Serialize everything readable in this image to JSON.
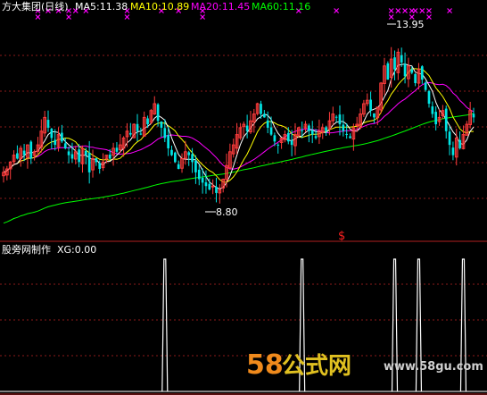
{
  "colors": {
    "background": "#000000",
    "up_candle": "#ff3c3c",
    "down_candle": "#00e5e5",
    "ma5": "#ffffff",
    "ma10": "#ffff00",
    "ma20": "#ff00ff",
    "ma60": "#00ff00",
    "signal_marker": "#ff00ff",
    "indicator_line": "#ffffff",
    "grid": "#8b1a1a",
    "label_text": "#ffffff"
  },
  "header": {
    "title": "方大集团(日线)",
    "ma5": "MA5:11.38",
    "ma10": "MA10:10.89",
    "ma20": "MA20:11.45",
    "ma60": "MA60:11.16"
  },
  "indicator_header": {
    "title": "股旁网制作",
    "value": "XG:0.00"
  },
  "marker": "$",
  "watermark": {
    "num": "58",
    "cn": "公式网",
    "url": "www.58gu.com"
  },
  "chart_data": [
    {
      "type": "candlestick",
      "title": "方大集团(日线)",
      "ylim": [
        8.0,
        14.3
      ],
      "moving_averages": [
        {
          "name": "MA5",
          "last": 11.38
        },
        {
          "name": "MA10",
          "last": 10.89
        },
        {
          "name": "MA20",
          "last": 11.45
        },
        {
          "name": "MA60",
          "last": 11.16
        }
      ],
      "close": [
        9.8,
        9.9,
        10.1,
        10.3,
        10.2,
        10.5,
        10.3,
        10.6,
        10.2,
        10.4,
        10.6,
        11.0,
        11.4,
        11.1,
        10.8,
        10.6,
        10.9,
        10.7,
        10.5,
        10.3,
        10.2,
        10.4,
        10.1,
        10.5,
        10.3,
        9.8,
        10.2,
        10.1,
        9.9,
        10.1,
        10.3,
        10.2,
        10.5,
        10.4,
        10.6,
        10.8,
        11.0,
        10.9,
        11.2,
        11.0,
        10.9,
        11.4,
        11.2,
        11.6,
        11.8,
        11.3,
        11.1,
        10.8,
        10.5,
        10.3,
        10.1,
        9.9,
        10.2,
        10.4,
        10.3,
        10.1,
        9.8,
        9.6,
        9.5,
        9.4,
        9.3,
        9.4,
        9.2,
        9.3,
        9.6,
        10.0,
        10.4,
        10.6,
        10.9,
        11.1,
        11.2,
        11.0,
        11.3,
        11.5,
        11.8,
        11.5,
        11.4,
        11.1,
        10.9,
        10.7,
        10.6,
        10.8,
        10.9,
        10.7,
        10.6,
        10.9,
        11.1,
        11.0,
        11.2,
        11.0,
        10.9,
        10.8,
        11.0,
        11.1,
        11.0,
        11.3,
        11.5,
        11.4,
        11.2,
        11.0,
        10.9,
        10.8,
        11.1,
        11.2,
        11.5,
        11.8,
        11.9,
        11.6,
        11.4,
        11.7,
        12.4,
        12.9,
        12.5,
        13.1,
        12.8,
        13.3,
        13.0,
        12.6,
        12.9,
        12.7,
        12.4,
        12.8,
        12.5,
        12.2,
        11.8,
        11.5,
        11.2,
        11.4,
        11.6,
        11.0,
        10.6,
        10.3,
        10.8,
        10.5,
        10.9,
        11.2,
        11.6,
        11.4
      ],
      "extremes": [
        {
          "label": "8.80",
          "value": 8.8
        },
        {
          "label": "13.95",
          "value": 13.95
        }
      ],
      "signals_top": [
        10,
        13,
        16,
        19,
        21,
        24,
        36,
        46,
        51,
        58,
        86,
        97,
        113,
        115,
        117,
        119,
        120,
        122,
        124,
        130
      ]
    },
    {
      "type": "line",
      "title": "股旁网制作",
      "series": [
        {
          "name": "XG",
          "last": 0.0
        }
      ],
      "spikes": [
        47,
        87,
        114,
        121,
        134
      ]
    }
  ]
}
